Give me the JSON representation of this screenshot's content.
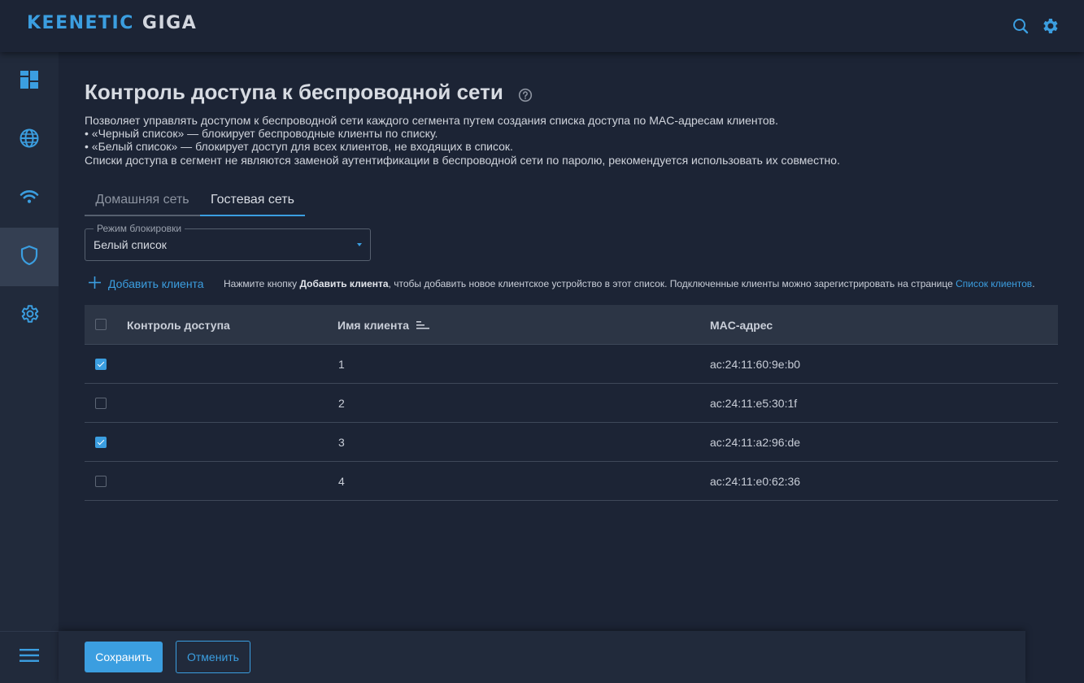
{
  "header": {
    "brand_primary": "KEENETIC",
    "brand_secondary": "GIGA",
    "icons": [
      "search-icon",
      "gear-icon"
    ],
    "accent_color": "#3b9ee0"
  },
  "sidebar": {
    "items": [
      {
        "icon": "dashboard-icon",
        "active": false
      },
      {
        "icon": "globe-icon",
        "active": false
      },
      {
        "icon": "wifi-icon",
        "active": false
      },
      {
        "icon": "shield-icon",
        "active": true
      },
      {
        "icon": "gear-icon",
        "active": false
      }
    ],
    "menu_icon": "menu-icon"
  },
  "page": {
    "title": "Контроль доступа к беспроводной сети",
    "help_icon": "help-icon",
    "description": [
      "Позволяет управлять доступом к беспроводной сети каждого сегмента путем создания списка доступа по MAC-адресам клиентов.",
      "• «Черный список» — блокирует беспроводные клиенты по списку.",
      "• «Белый список» — блокирует доступ для всех клиентов, не входящих в список.",
      "Списки доступа в сегмент не являются заменой аутентификации в беспроводной сети по паролю, рекомендуется использовать их совместно."
    ]
  },
  "tabs": [
    {
      "label": "Домашняя сеть",
      "active": false
    },
    {
      "label": "Гостевая сеть",
      "active": true
    }
  ],
  "block_mode": {
    "legend": "Режим блокировки",
    "value": "Белый список"
  },
  "add_client": {
    "label": "Добавить клиента",
    "hint_prefix": "Нажмите кнопку ",
    "hint_bold": "Добавить клиента",
    "hint_middle": ", чтобы добавить новое клиентское устройство в этот список. Подключенные клиенты можно зарегистрировать на странице ",
    "hint_link": "Список клиентов",
    "hint_suffix": "."
  },
  "table": {
    "columns": {
      "access": "Контроль доступа",
      "name": "Имя клиента",
      "mac": "MAC-адрес"
    },
    "rows": [
      {
        "checked": true,
        "name": "1",
        "mac": "ac:24:11:60:9e:b0"
      },
      {
        "checked": false,
        "name": "2",
        "mac": "ac:24:11:e5:30:1f"
      },
      {
        "checked": true,
        "name": "3",
        "mac": "ac:24:11:a2:96:de"
      },
      {
        "checked": false,
        "name": "4",
        "mac": "ac:24:11:e0:62:36"
      }
    ]
  },
  "footer": {
    "save_label": "Сохранить",
    "cancel_label": "Отменить"
  }
}
